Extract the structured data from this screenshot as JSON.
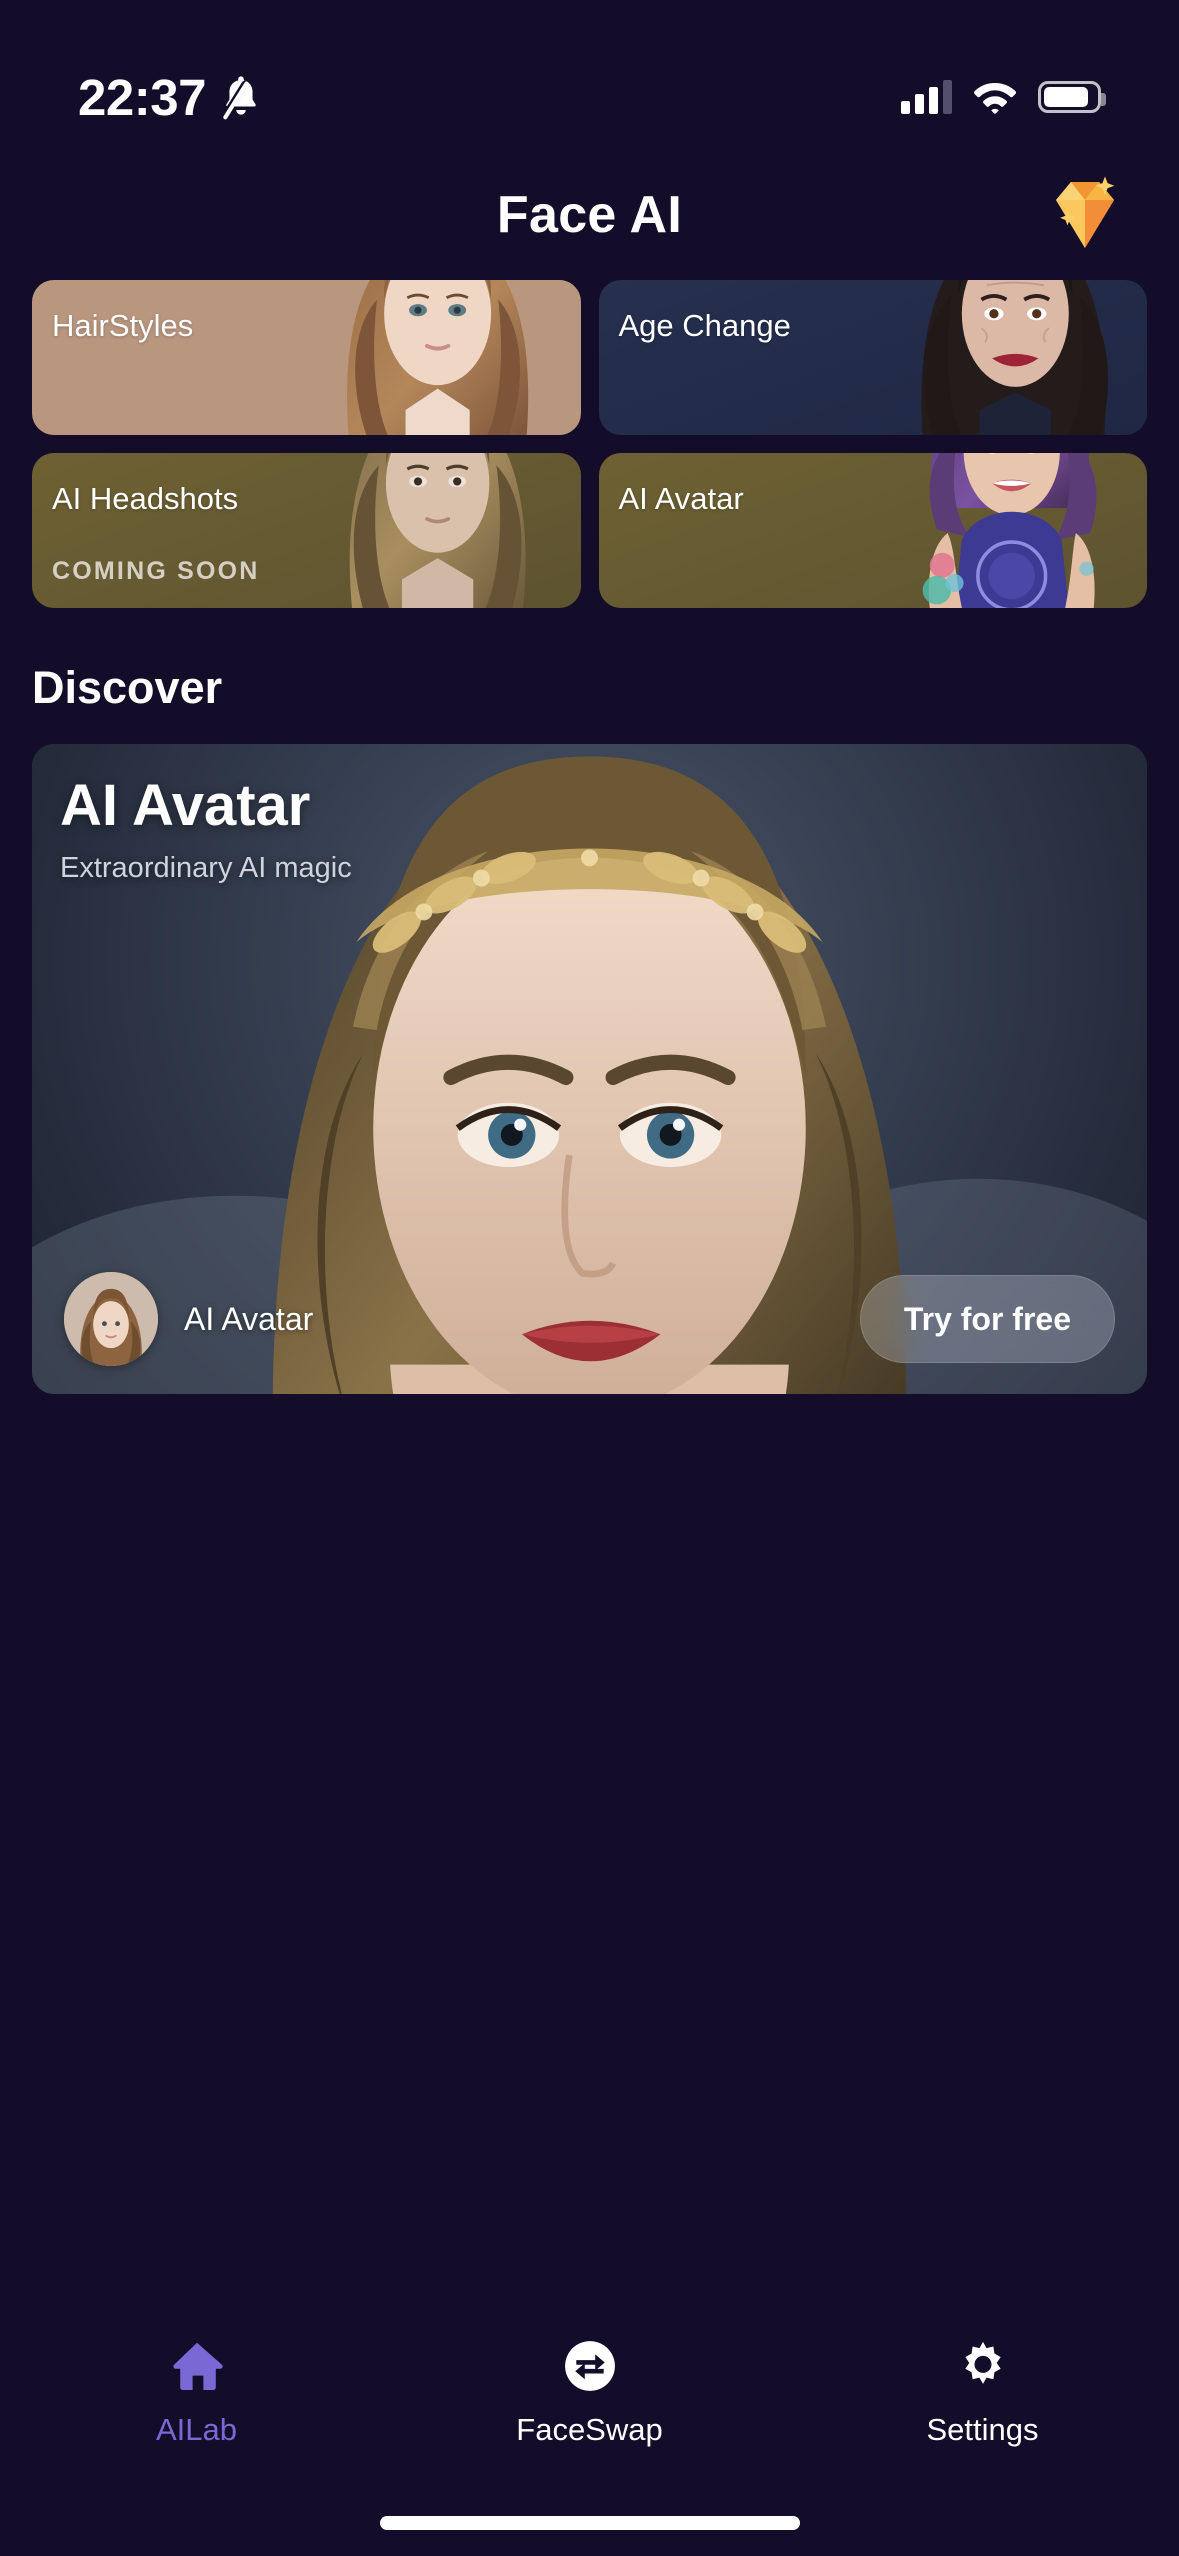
{
  "status_bar": {
    "time": "22:37",
    "mute_icon": "bell-muted-icon",
    "signal_icon": "cellular-signal-icon",
    "wifi_icon": "wifi-icon",
    "battery_icon": "battery-icon"
  },
  "header": {
    "title": "Face AI",
    "premium_icon": "diamond-gem-icon"
  },
  "features": [
    {
      "label": "HairStyles",
      "badge": "",
      "theme": "tan",
      "art": "woman-brown-hair-portrait"
    },
    {
      "label": "Age Change",
      "badge": "",
      "theme": "navy",
      "art": "older-woman-portrait"
    },
    {
      "label": "AI Headshots",
      "badge": "COMING SOON",
      "theme": "olive",
      "art": "woman-headshot-portrait"
    },
    {
      "label": "AI Avatar",
      "badge": "",
      "theme": "olive",
      "art": "purple-hair-tattoo-woman-portrait"
    }
  ],
  "discover": {
    "section_title": "Discover",
    "hero": {
      "title": "AI Avatar",
      "subtitle": "Extraordinary AI magic",
      "art": "vintage-woman-laurel-crown-portrait",
      "footer_avatar": "woman-brown-hair-thumbnail",
      "footer_label": "AI Avatar",
      "cta_label": "Try for free"
    }
  },
  "tabs": [
    {
      "label": "AILab",
      "icon": "home-icon",
      "active": true
    },
    {
      "label": "FaceSwap",
      "icon": "face-swap-icon",
      "active": false
    },
    {
      "label": "Settings",
      "icon": "gear-icon",
      "active": false
    }
  ],
  "colors": {
    "background": "#130d2a",
    "accent": "#7a68d4",
    "card_tan": "#b9977f",
    "card_navy": "#26304f",
    "card_olive": "#6e6133",
    "gem_gold": "#f6b33d"
  }
}
